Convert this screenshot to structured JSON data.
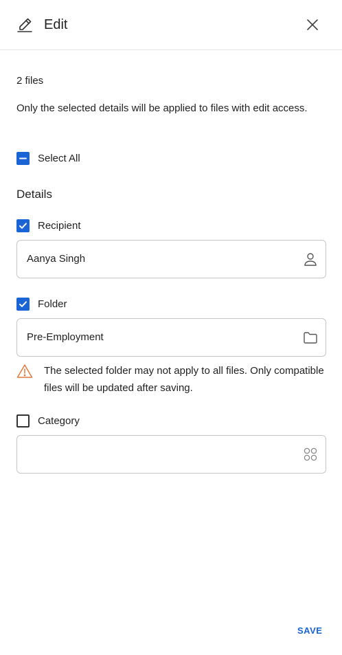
{
  "header": {
    "title": "Edit",
    "edit_icon": "pencil-icon",
    "close_icon": "close-icon"
  },
  "summary": {
    "file_count": "2 files",
    "description": "Only the selected details will be applied to files with edit access."
  },
  "select_all": {
    "label": "Select All",
    "state": "indeterminate"
  },
  "details": {
    "heading": "Details",
    "recipient": {
      "label": "Recipient",
      "checked": true,
      "value": "Aanya Singh",
      "icon": "person-icon"
    },
    "folder": {
      "label": "Folder",
      "checked": true,
      "value": "Pre-Employment",
      "icon": "folder-icon"
    },
    "warning": {
      "text": "The selected folder may not apply to all files. Only compatible files will be updated after saving.",
      "icon": "warning-icon",
      "color": "#e07a3c"
    },
    "category": {
      "label": "Category",
      "checked": false,
      "value": "",
      "icon": "grid-icon"
    }
  },
  "footer": {
    "save_label": "SAVE"
  },
  "colors": {
    "accent": "#1a64d6",
    "border": "#c7c7c7",
    "warning": "#e07a3c"
  }
}
